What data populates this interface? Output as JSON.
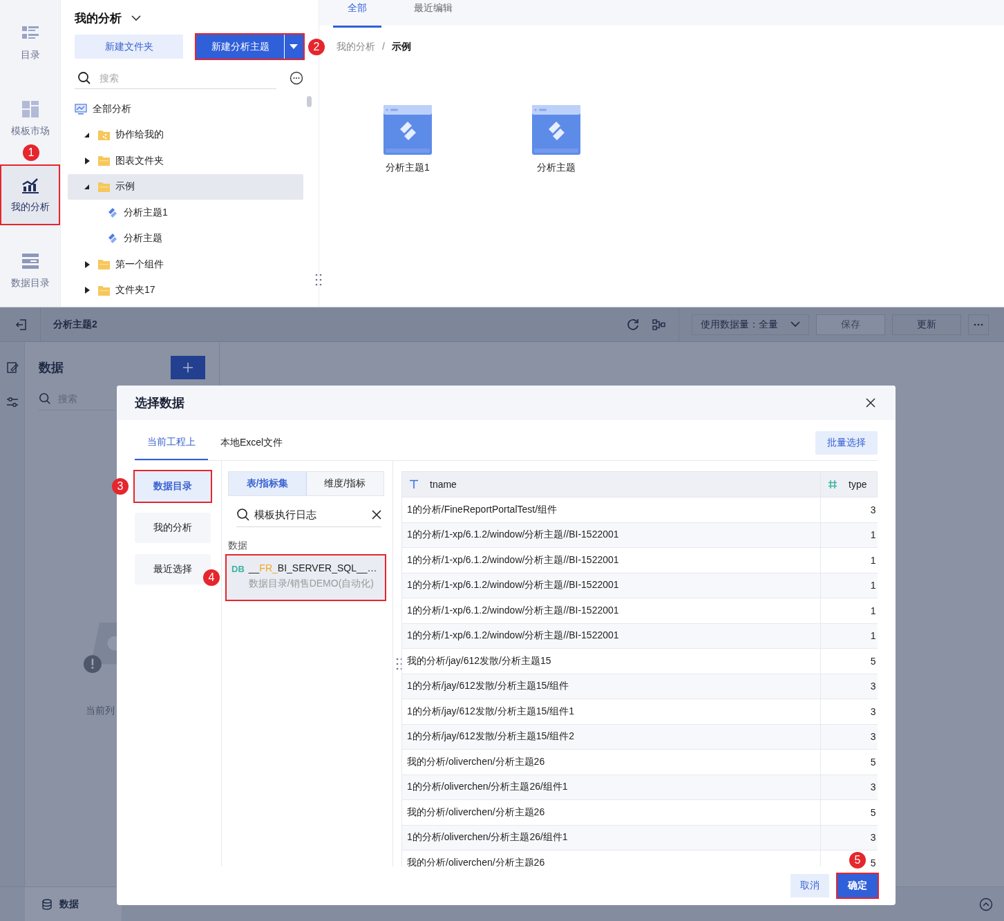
{
  "rail": {
    "items": [
      {
        "label": "目录",
        "kind": "catalog",
        "selected": false
      },
      {
        "label": "模板市场",
        "kind": "market",
        "selected": false
      },
      {
        "label": "我的分析",
        "kind": "analysis",
        "selected": true,
        "callout": "1"
      },
      {
        "label": "数据目录",
        "kind": "data",
        "selected": false
      }
    ]
  },
  "tree_panel": {
    "title": "我的分析",
    "new_folder_button": "新建文件夹",
    "new_topic_button": {
      "label": "新建分析主题",
      "callout": "2"
    },
    "search": {
      "placeholder": "搜索"
    },
    "tree": [
      {
        "label": "全部分析",
        "kind": "root",
        "selected": false,
        "children": [
          {
            "label": "协作给我的",
            "kind": "shared",
            "selected": false,
            "expanded": true
          },
          {
            "label": "图表文件夹",
            "kind": "folder",
            "selected": false,
            "expanded": false
          },
          {
            "label": "示例",
            "kind": "folder",
            "selected": true,
            "expanded": true,
            "children": [
              {
                "label": "分析主题1",
                "kind": "topic",
                "selected": false
              },
              {
                "label": "分析主题",
                "kind": "topic",
                "selected": false
              }
            ]
          },
          {
            "label": "第一个组件",
            "kind": "folder",
            "selected": false,
            "expanded": false
          },
          {
            "label": "文件夹17",
            "kind": "folder",
            "selected": false,
            "expanded": false
          }
        ]
      }
    ]
  },
  "content": {
    "tabs": [
      {
        "label": "全部",
        "selected": true
      },
      {
        "label": "最近编辑",
        "selected": false
      }
    ],
    "breadcrumb": [
      "我的分析",
      "/",
      "示例"
    ],
    "cards": [
      {
        "label": "分析主题1"
      },
      {
        "label": "分析主题"
      }
    ]
  },
  "editor": {
    "title": "分析主题2",
    "data_volume": "使用数据量：全量",
    "save_button": {
      "label": "保存",
      "disabled": true
    },
    "update_button": "更新",
    "data_panel": {
      "title": "数据",
      "search": {
        "placeholder": "搜索"
      },
      "empty_text": "当前列"
    },
    "bottom_tab": "数据"
  },
  "dialog": {
    "title": "选择数据",
    "tabs": [
      {
        "label": "当前工程上",
        "selected": true
      },
      {
        "label": "本地Excel文件",
        "selected": false
      }
    ],
    "batch_button": "批量选择",
    "sources": [
      {
        "label": "数据目录",
        "selected": true,
        "callout": "3"
      },
      {
        "label": "我的分析",
        "selected": false
      },
      {
        "label": "最近选择",
        "selected": false
      }
    ],
    "segments": [
      {
        "label": "表/指标集",
        "selected": true
      },
      {
        "label": "维度/指标",
        "selected": false
      }
    ],
    "search": {
      "value": "模板执行日志"
    },
    "section_label": "数据",
    "results": [
      {
        "badge": "DB",
        "name_prefix": "__",
        "name_highlight": "FR_",
        "name_rest": "BI_SERVER_SQL__…",
        "path": "数据目录/销售DEMO(自动化)",
        "selected": true,
        "callout": "4"
      }
    ],
    "table": {
      "columns": [
        {
          "label": "tname",
          "kind": "text"
        },
        {
          "label": "type",
          "kind": "number"
        }
      ],
      "rows": [
        [
          "1的分析/FineReportPortalTest/组件",
          "3"
        ],
        [
          "1的分析/1-xp/6.1.2/window/分析主题//BI-1522001",
          "1"
        ],
        [
          "1的分析/1-xp/6.1.2/window/分析主题//BI-1522001",
          "1"
        ],
        [
          "1的分析/1-xp/6.1.2/window/分析主题//BI-1522001",
          "1"
        ],
        [
          "1的分析/1-xp/6.1.2/window/分析主题//BI-1522001",
          "1"
        ],
        [
          "1的分析/1-xp/6.1.2/window/分析主题//BI-1522001",
          "1"
        ],
        [
          "我的分析/jay/612发散/分析主题15",
          "5"
        ],
        [
          "1的分析/jay/612发散/分析主题15/组件",
          "3"
        ],
        [
          "1的分析/jay/612发散/分析主题15/组件1",
          "3"
        ],
        [
          "1的分析/jay/612发散/分析主题15/组件2",
          "3"
        ],
        [
          "我的分析/oliverchen/分析主题26",
          "5"
        ],
        [
          "1的分析/oliverchen/分析主题26/组件1",
          "3"
        ],
        [
          "我的分析/oliverchen/分析主题26",
          "5"
        ],
        [
          "1的分析/oliverchen/分析主题26/组件1",
          "3"
        ],
        [
          "我的分析/oliverchen/分析主题26",
          "5"
        ]
      ]
    },
    "cancel_button": "取消",
    "ok_button": {
      "label": "确定",
      "callout": "5"
    }
  }
}
